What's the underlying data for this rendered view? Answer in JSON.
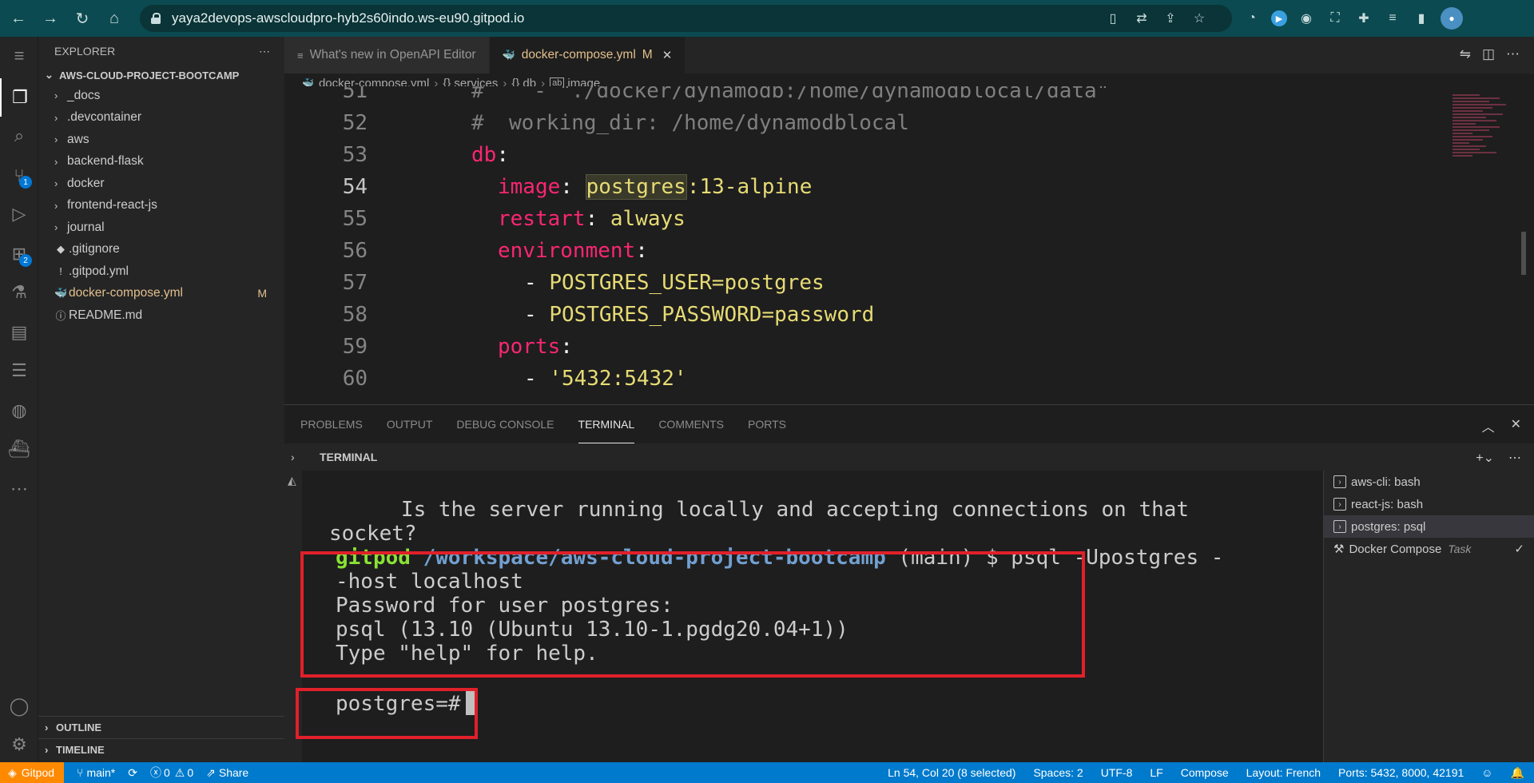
{
  "browser": {
    "url": "yaya2devops-awscloudpro-hyb2s60indo.ws-eu90.gitpod.io"
  },
  "sidebar": {
    "title": "EXPLORER",
    "project": "AWS-CLOUD-PROJECT-BOOTCAMP",
    "items": [
      {
        "label": "_docs",
        "type": "folder"
      },
      {
        "label": ".devcontainer",
        "type": "folder"
      },
      {
        "label": "aws",
        "type": "folder"
      },
      {
        "label": "backend-flask",
        "type": "folder"
      },
      {
        "label": "docker",
        "type": "folder"
      },
      {
        "label": "frontend-react-js",
        "type": "folder"
      },
      {
        "label": "journal",
        "type": "folder"
      },
      {
        "label": ".gitignore",
        "type": "file",
        "icon": "◆"
      },
      {
        "label": ".gitpod.yml",
        "type": "file",
        "icon": "!"
      },
      {
        "label": "docker-compose.yml",
        "type": "file",
        "icon": "🐳",
        "badge": "M"
      },
      {
        "label": "README.md",
        "type": "file",
        "icon": "ⓘ"
      }
    ],
    "outline": "OUTLINE",
    "timeline": "TIMELINE"
  },
  "activity": {
    "source_control_badge": "1",
    "extensions_badge": "2"
  },
  "tabs": [
    {
      "label": "What's new in OpenAPI Editor",
      "icon": "≡"
    },
    {
      "label": "docker-compose.yml",
      "icon": "🐳",
      "mod": "M",
      "close": "✕"
    }
  ],
  "breadcrumb": {
    "file": "docker-compose.yml",
    "b1": "services",
    "b2": "db",
    "b3": "image",
    "b1_icon": "{}",
    "b2_icon": "{}"
  },
  "code": {
    "l51": {
      "num": "51",
      "text": "#    - \"./docker/dynamodb:/home/dynamodblocal/data\""
    },
    "l52": {
      "num": "52",
      "text": "#  working_dir: /home/dynamodblocal"
    },
    "l53": {
      "num": "53",
      "key": "db",
      "colon": ":"
    },
    "l54": {
      "num": "54",
      "key": "image",
      "colon": ": ",
      "val_hl": "postgres",
      "val": ":13-alpine"
    },
    "l55": {
      "num": "55",
      "key": "restart",
      "colon": ": ",
      "val": "always"
    },
    "l56": {
      "num": "56",
      "key": "environment",
      "colon": ":"
    },
    "l57": {
      "num": "57",
      "dash": "- ",
      "val": "POSTGRES_USER=postgres"
    },
    "l58": {
      "num": "58",
      "dash": "- ",
      "val": "POSTGRES_PASSWORD=password"
    },
    "l59": {
      "num": "59",
      "key": "ports",
      "colon": ":"
    },
    "l60": {
      "num": "60",
      "dash": "- ",
      "val": "'5432:5432'"
    }
  },
  "panel": {
    "tabs": [
      "PROBLEMS",
      "OUTPUT",
      "DEBUG CONSOLE",
      "TERMINAL",
      "COMMENTS",
      "PORTS"
    ],
    "active_tab": "TERMINAL",
    "terminal_title": "TERMINAL"
  },
  "terminal": {
    "line1": "      Is the server running locally and accepting connections on that",
    "line2": "socket?",
    "prompt_user": "gitpod",
    "prompt_path": "/workspace/aws-cloud-project-bootcamp",
    "prompt_rest": " (main) $ psql -Upostgres -",
    "line4": "-host localhost",
    "line5": "Password for user postgres:",
    "line6": "psql (13.10 (Ubuntu 13.10-1.pgdg20.04+1))",
    "line7": "Type \"help\" for help.",
    "line8": "postgres=#"
  },
  "terminal_list": [
    {
      "label": "aws-cli: bash"
    },
    {
      "label": "react-js: bash"
    },
    {
      "label": "postgres: psql"
    },
    {
      "label": "Docker Compose",
      "tag": "Task"
    }
  ],
  "statusbar": {
    "remote": "Gitpod",
    "branch": "main*",
    "errors": "0",
    "warnings": "0",
    "share": "Share",
    "position": "Ln 54, Col 20 (8 selected)",
    "spaces": "Spaces: 2",
    "encoding": "UTF-8",
    "eol": "LF",
    "language": "Compose",
    "layout": "Layout: French",
    "ports": "Ports: 5432, 8000, 42191"
  },
  "colors": {
    "accent": "#007acc",
    "remote": "#ff8a00",
    "highlight_box": "#e0202a",
    "browser_bar": "#0b4a50"
  }
}
